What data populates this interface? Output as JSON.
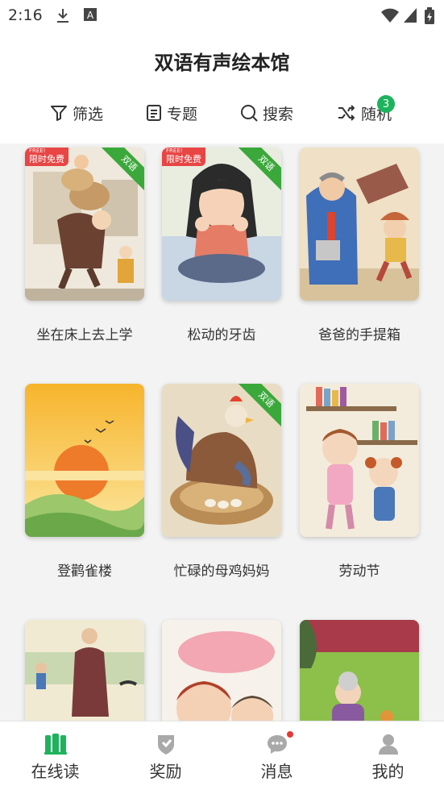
{
  "status_bar": {
    "time": "2:16",
    "icons": [
      "download-icon",
      "a-icon",
      "wifi-icon",
      "signal-icon",
      "battery-charging-icon"
    ]
  },
  "header": {
    "title": "双语有声绘本馆"
  },
  "menu": {
    "filter": {
      "label": "筛选",
      "icon": "filter-icon"
    },
    "topics": {
      "label": "专题",
      "icon": "topic-icon"
    },
    "search": {
      "label": "搜索",
      "icon": "search-icon"
    },
    "random": {
      "label": "随机",
      "icon": "shuffle-icon",
      "badge": "3"
    }
  },
  "books": [
    {
      "title": "坐在床上去上学",
      "free_label": "限时免费",
      "free_sub": "FREE!",
      "bilingual_label": "双语"
    },
    {
      "title": "松动的牙齿",
      "free_label": "限时免费",
      "free_sub": "FREE!",
      "bilingual_label": "双语"
    },
    {
      "title": "爸爸的手提箱"
    },
    {
      "title": "登鹳雀楼"
    },
    {
      "title": "忙碌的母鸡妈妈",
      "bilingual_label": "双语"
    },
    {
      "title": "劳动节"
    },
    {
      "title": ""
    },
    {
      "title": ""
    },
    {
      "title": ""
    }
  ],
  "tabbar": [
    {
      "label": "在线读",
      "icon": "books-icon",
      "active": true
    },
    {
      "label": "奖励",
      "icon": "reward-icon"
    },
    {
      "label": "消息",
      "icon": "message-icon",
      "has_dot": true
    },
    {
      "label": "我的",
      "icon": "profile-icon"
    }
  ],
  "colors": {
    "accent": "#1db35c",
    "free_red": "#e84545",
    "bilingual_green": "#3aa83a"
  }
}
